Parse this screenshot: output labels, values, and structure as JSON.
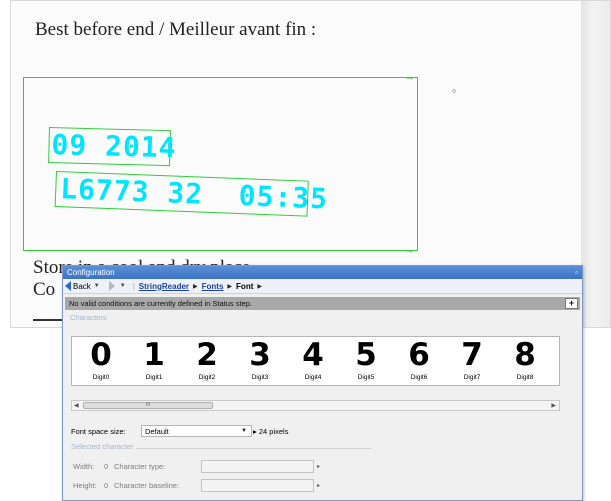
{
  "image": {
    "title_text": "Best before end / Meilleur avant fin :",
    "bottom_line1": "Store in a cool and dry place",
    "bottom_line2": "Co",
    "ocr_line1": "09 2014",
    "ocr_line2": "L6773 32  05:35",
    "colors": {
      "roi": "#2fce3b",
      "ocr_text": "#00e5ff"
    }
  },
  "panel": {
    "title": "Configuration",
    "nav": {
      "back_label": "Back",
      "crumbs": [
        "StringReader",
        "Fonts",
        "Font"
      ]
    },
    "status_message": "No valid conditions are currently defined in Status step.",
    "characters_label": "Characters",
    "characters": [
      {
        "glyph": "0",
        "name": "Digit0"
      },
      {
        "glyph": "1",
        "name": "Digit1"
      },
      {
        "glyph": "2",
        "name": "Digit2"
      },
      {
        "glyph": "3",
        "name": "Digit3"
      },
      {
        "glyph": "4",
        "name": "Digit4"
      },
      {
        "glyph": "5",
        "name": "Digit5"
      },
      {
        "glyph": "6",
        "name": "Digit6"
      },
      {
        "glyph": "7",
        "name": "Digit7"
      },
      {
        "glyph": "8",
        "name": "Digit8"
      }
    ],
    "scroll_thumb_label": "III",
    "font_space": {
      "label": "Font space size:",
      "value": "Default",
      "unit": "24 pixels"
    },
    "selected_character": {
      "label": "Selected character",
      "width_label": "Width:",
      "width_value": "0",
      "height_label": "Height:",
      "height_value": "0",
      "type_label": "Character type:",
      "baseline_label": "Character baseline:"
    }
  }
}
